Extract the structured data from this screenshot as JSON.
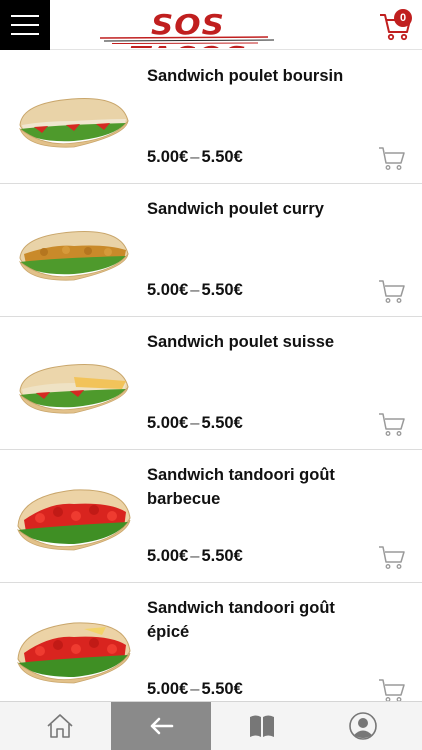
{
  "header": {
    "menu_icon": "hamburger-menu-icon",
    "logo_text": "SOS TACOS",
    "cart_icon": "shopping-cart-icon",
    "cart_count": "0",
    "brand_color": "#c01f1f"
  },
  "products": [
    {
      "name": "Sandwich poulet boursin",
      "price_min": "5.00€",
      "price_sep": "–",
      "price_max": "5.50€",
      "filling": "#f0e6d0"
    },
    {
      "name": "Sandwich poulet curry",
      "price_min": "5.00€",
      "price_sep": "–",
      "price_max": "5.50€",
      "filling": "#c98a2a"
    },
    {
      "name": "Sandwich poulet suisse",
      "price_min": "5.00€",
      "price_sep": "–",
      "price_max": "5.50€",
      "filling": "#efe2c4"
    },
    {
      "name": "Sandwich tandoori goût barbecue",
      "price_min": "5.00€",
      "price_sep": "–",
      "price_max": "5.50€",
      "filling": "#d9241f"
    },
    {
      "name": "Sandwich tandoori goût épicé",
      "price_min": "5.00€",
      "price_sep": "–",
      "price_max": "5.50€",
      "filling": "#d9241f"
    }
  ],
  "bottom_nav": {
    "items": [
      "home-icon",
      "back-arrow-icon",
      "book-icon",
      "user-icon"
    ],
    "active": "back-arrow-icon"
  }
}
